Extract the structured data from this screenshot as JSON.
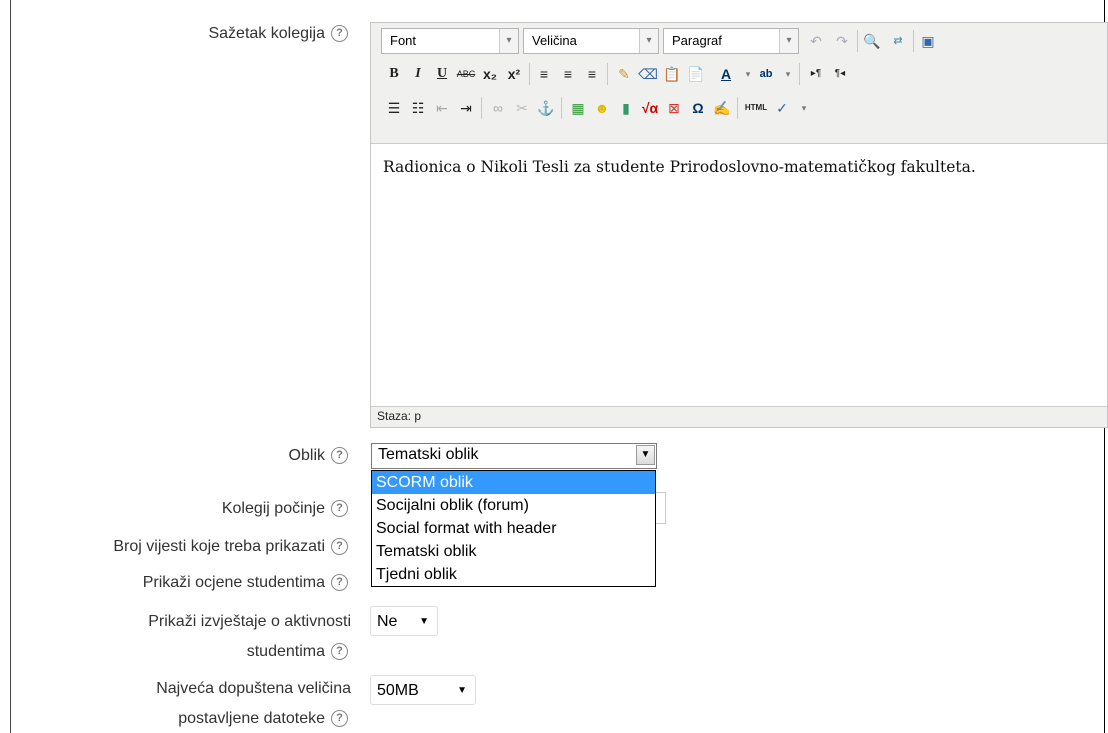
{
  "labels": {
    "summary": "Sažetak kolegija",
    "format": "Oblik",
    "start_date": "Kolegij počinje",
    "news_items": "Broj vijesti koje treba prikazati",
    "show_grades": "Prikaži ocjene studentima",
    "activity_reports_1": "Prikaži izvještaje o aktivnosti",
    "activity_reports_2": "studentima",
    "max_upload_1": "Najveća dopuštena veličina",
    "max_upload_2": "postavljene datoteke"
  },
  "editor": {
    "font_select": "Font",
    "size_select": "Veličina",
    "paragraph_select": "Paragraf",
    "content": "Radionica o Nikoli Tesli za studente Prirodoslovno-matematičkog fakulteta.",
    "path": "Staza: p"
  },
  "format_select": {
    "value": "Tematski oblik",
    "options": [
      "SCORM oblik",
      "Socijalni oblik (forum)",
      "Social format with header",
      "Tematski oblik",
      "Tjedni oblik"
    ],
    "highlighted": "SCORM oblik"
  },
  "activity_reports_select": {
    "value": "Ne"
  },
  "max_upload_select": {
    "value": "50MB"
  },
  "help_glyph": "?",
  "icons": [
    "undo-icon",
    "redo-icon",
    "find-icon",
    "replace-icon",
    "fullscreen-icon",
    "bold-icon",
    "italic-icon",
    "underline-icon",
    "strikethrough-icon",
    "subscript-icon",
    "superscript-icon",
    "align-left-icon",
    "align-center-icon",
    "align-right-icon",
    "cleanup-icon",
    "eraser-icon",
    "paste-text-icon",
    "paste-word-icon",
    "text-color-icon",
    "highlight-icon",
    "ltr-icon",
    "rtl-icon",
    "bullet-list-icon",
    "numbered-list-icon",
    "outdent-icon",
    "indent-icon",
    "link-icon",
    "unlink-icon",
    "anchor-icon",
    "image-icon",
    "emoticon-icon",
    "media-icon",
    "equation-icon",
    "nolink-icon",
    "special-char-icon",
    "edit-icon",
    "html-icon",
    "spellcheck-icon"
  ]
}
